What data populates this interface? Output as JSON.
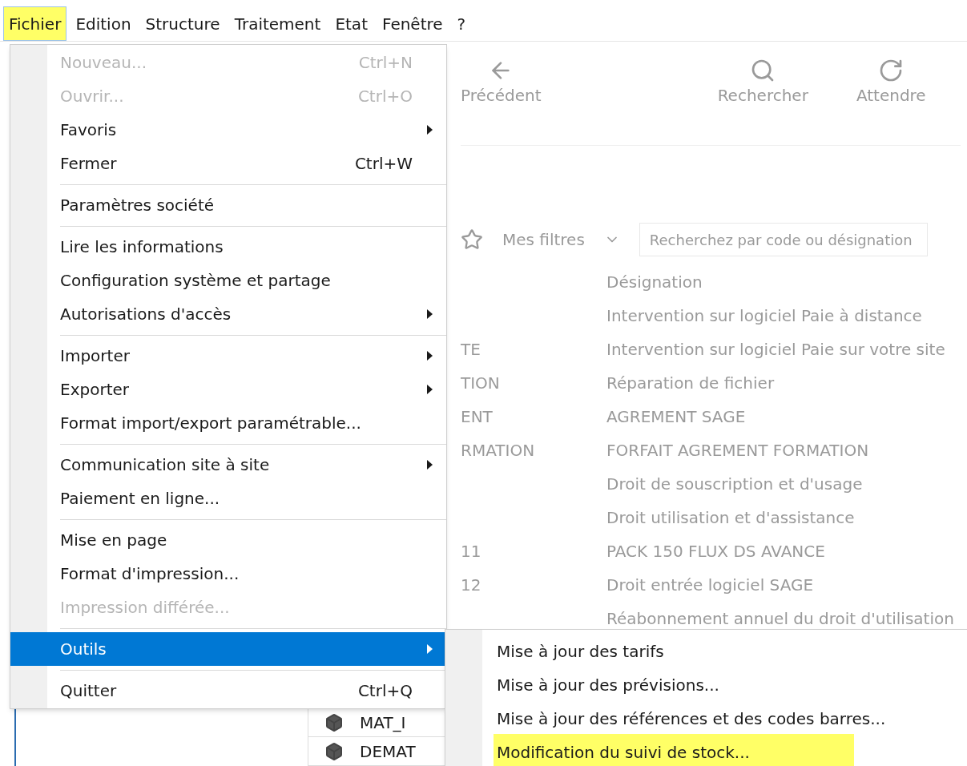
{
  "menubar": [
    {
      "label": "Fichier",
      "selected": true,
      "highlighted": true
    },
    {
      "label": "Edition",
      "selected": false,
      "highlighted": false
    },
    {
      "label": "Structure",
      "selected": false,
      "highlighted": false
    },
    {
      "label": "Traitement",
      "selected": false,
      "highlighted": false
    },
    {
      "label": "Etat",
      "selected": false,
      "highlighted": false
    },
    {
      "label": "Fenêtre",
      "selected": false,
      "highlighted": false
    },
    {
      "label": "?",
      "selected": false,
      "highlighted": false
    }
  ],
  "background": {
    "toolbar": [
      {
        "kind": "back",
        "label": "Précédent"
      },
      {
        "kind": "search",
        "label": "Rechercher"
      },
      {
        "kind": "wait",
        "label": "Attendre"
      }
    ],
    "filter_label": "Mes filtres",
    "search_placeholder": "Recherchez par code ou désignation",
    "column_header": "Désignation",
    "rows": [
      {
        "code": "",
        "designation": "Intervention sur logiciel Paie à distance"
      },
      {
        "code": "TE",
        "designation": "Intervention sur logiciel Paie sur votre site"
      },
      {
        "code": "TION",
        "designation": "Réparation de fichier"
      },
      {
        "code": "ENT",
        "designation": "AGREMENT SAGE"
      },
      {
        "code": "RMATION",
        "designation": "FORFAIT AGREMENT FORMATION"
      },
      {
        "code": "",
        "designation": "Droit de souscription et d'usage"
      },
      {
        "code": "",
        "designation": "Droit utilisation et d'assistance"
      },
      {
        "code": "11",
        "designation": "PACK 150 FLUX DS AVANCE"
      },
      {
        "code": "12",
        "designation": "Droit entrée logiciel SAGE"
      },
      {
        "code": "",
        "designation": "Réabonnement annuel du droit d'utilisation"
      }
    ],
    "bottom_rows": [
      "MAT_I",
      "DEMAT"
    ]
  },
  "file_menu": {
    "items": [
      {
        "kind": "item",
        "label": "Nouveau...",
        "shortcut": "Ctrl+N",
        "disabled": true,
        "submenu": false,
        "selected": false
      },
      {
        "kind": "item",
        "label": "Ouvrir...",
        "shortcut": "Ctrl+O",
        "disabled": true,
        "submenu": false,
        "selected": false
      },
      {
        "kind": "item",
        "label": "Favoris",
        "disabled": false,
        "submenu": true,
        "selected": false
      },
      {
        "kind": "item",
        "label": "Fermer",
        "shortcut": "Ctrl+W",
        "disabled": false,
        "submenu": false,
        "selected": false
      },
      {
        "kind": "separator"
      },
      {
        "kind": "item",
        "label": "Paramètres société",
        "disabled": false,
        "submenu": false,
        "selected": false
      },
      {
        "kind": "separator"
      },
      {
        "kind": "item",
        "label": "Lire les informations",
        "disabled": false,
        "submenu": false,
        "selected": false
      },
      {
        "kind": "item",
        "label": "Configuration système et partage",
        "disabled": false,
        "submenu": false,
        "selected": false
      },
      {
        "kind": "item",
        "label": "Autorisations d'accès",
        "disabled": false,
        "submenu": true,
        "selected": false
      },
      {
        "kind": "separator"
      },
      {
        "kind": "item",
        "label": "Importer",
        "disabled": false,
        "submenu": true,
        "selected": false
      },
      {
        "kind": "item",
        "label": "Exporter",
        "disabled": false,
        "submenu": true,
        "selected": false
      },
      {
        "kind": "item",
        "label": "Format import/export paramétrable...",
        "disabled": false,
        "submenu": false,
        "selected": false
      },
      {
        "kind": "separator"
      },
      {
        "kind": "item",
        "label": "Communication site à site",
        "disabled": false,
        "submenu": true,
        "selected": false
      },
      {
        "kind": "item",
        "label": "Paiement en ligne...",
        "disabled": false,
        "submenu": false,
        "selected": false
      },
      {
        "kind": "separator"
      },
      {
        "kind": "item",
        "label": "Mise en page",
        "disabled": false,
        "submenu": false,
        "selected": false
      },
      {
        "kind": "item",
        "label": "Format d'impression...",
        "disabled": false,
        "submenu": false,
        "selected": false
      },
      {
        "kind": "item",
        "label": "Impression différée...",
        "disabled": true,
        "submenu": false,
        "selected": false
      },
      {
        "kind": "separator"
      },
      {
        "kind": "item",
        "label": "Outils",
        "disabled": false,
        "submenu": true,
        "selected": true
      },
      {
        "kind": "separator"
      },
      {
        "kind": "item",
        "label": "Quitter",
        "shortcut": "Ctrl+Q",
        "disabled": false,
        "submenu": false,
        "selected": false
      }
    ]
  },
  "tools_submenu": {
    "items": [
      {
        "label": "Mise à jour des tarifs",
        "highlighted": false
      },
      {
        "label": "Mise à jour des prévisions...",
        "highlighted": false
      },
      {
        "label": "Mise à jour des références et des codes barres...",
        "highlighted": false
      },
      {
        "label": "Modification du suivi de stock...",
        "highlighted": true
      }
    ]
  }
}
